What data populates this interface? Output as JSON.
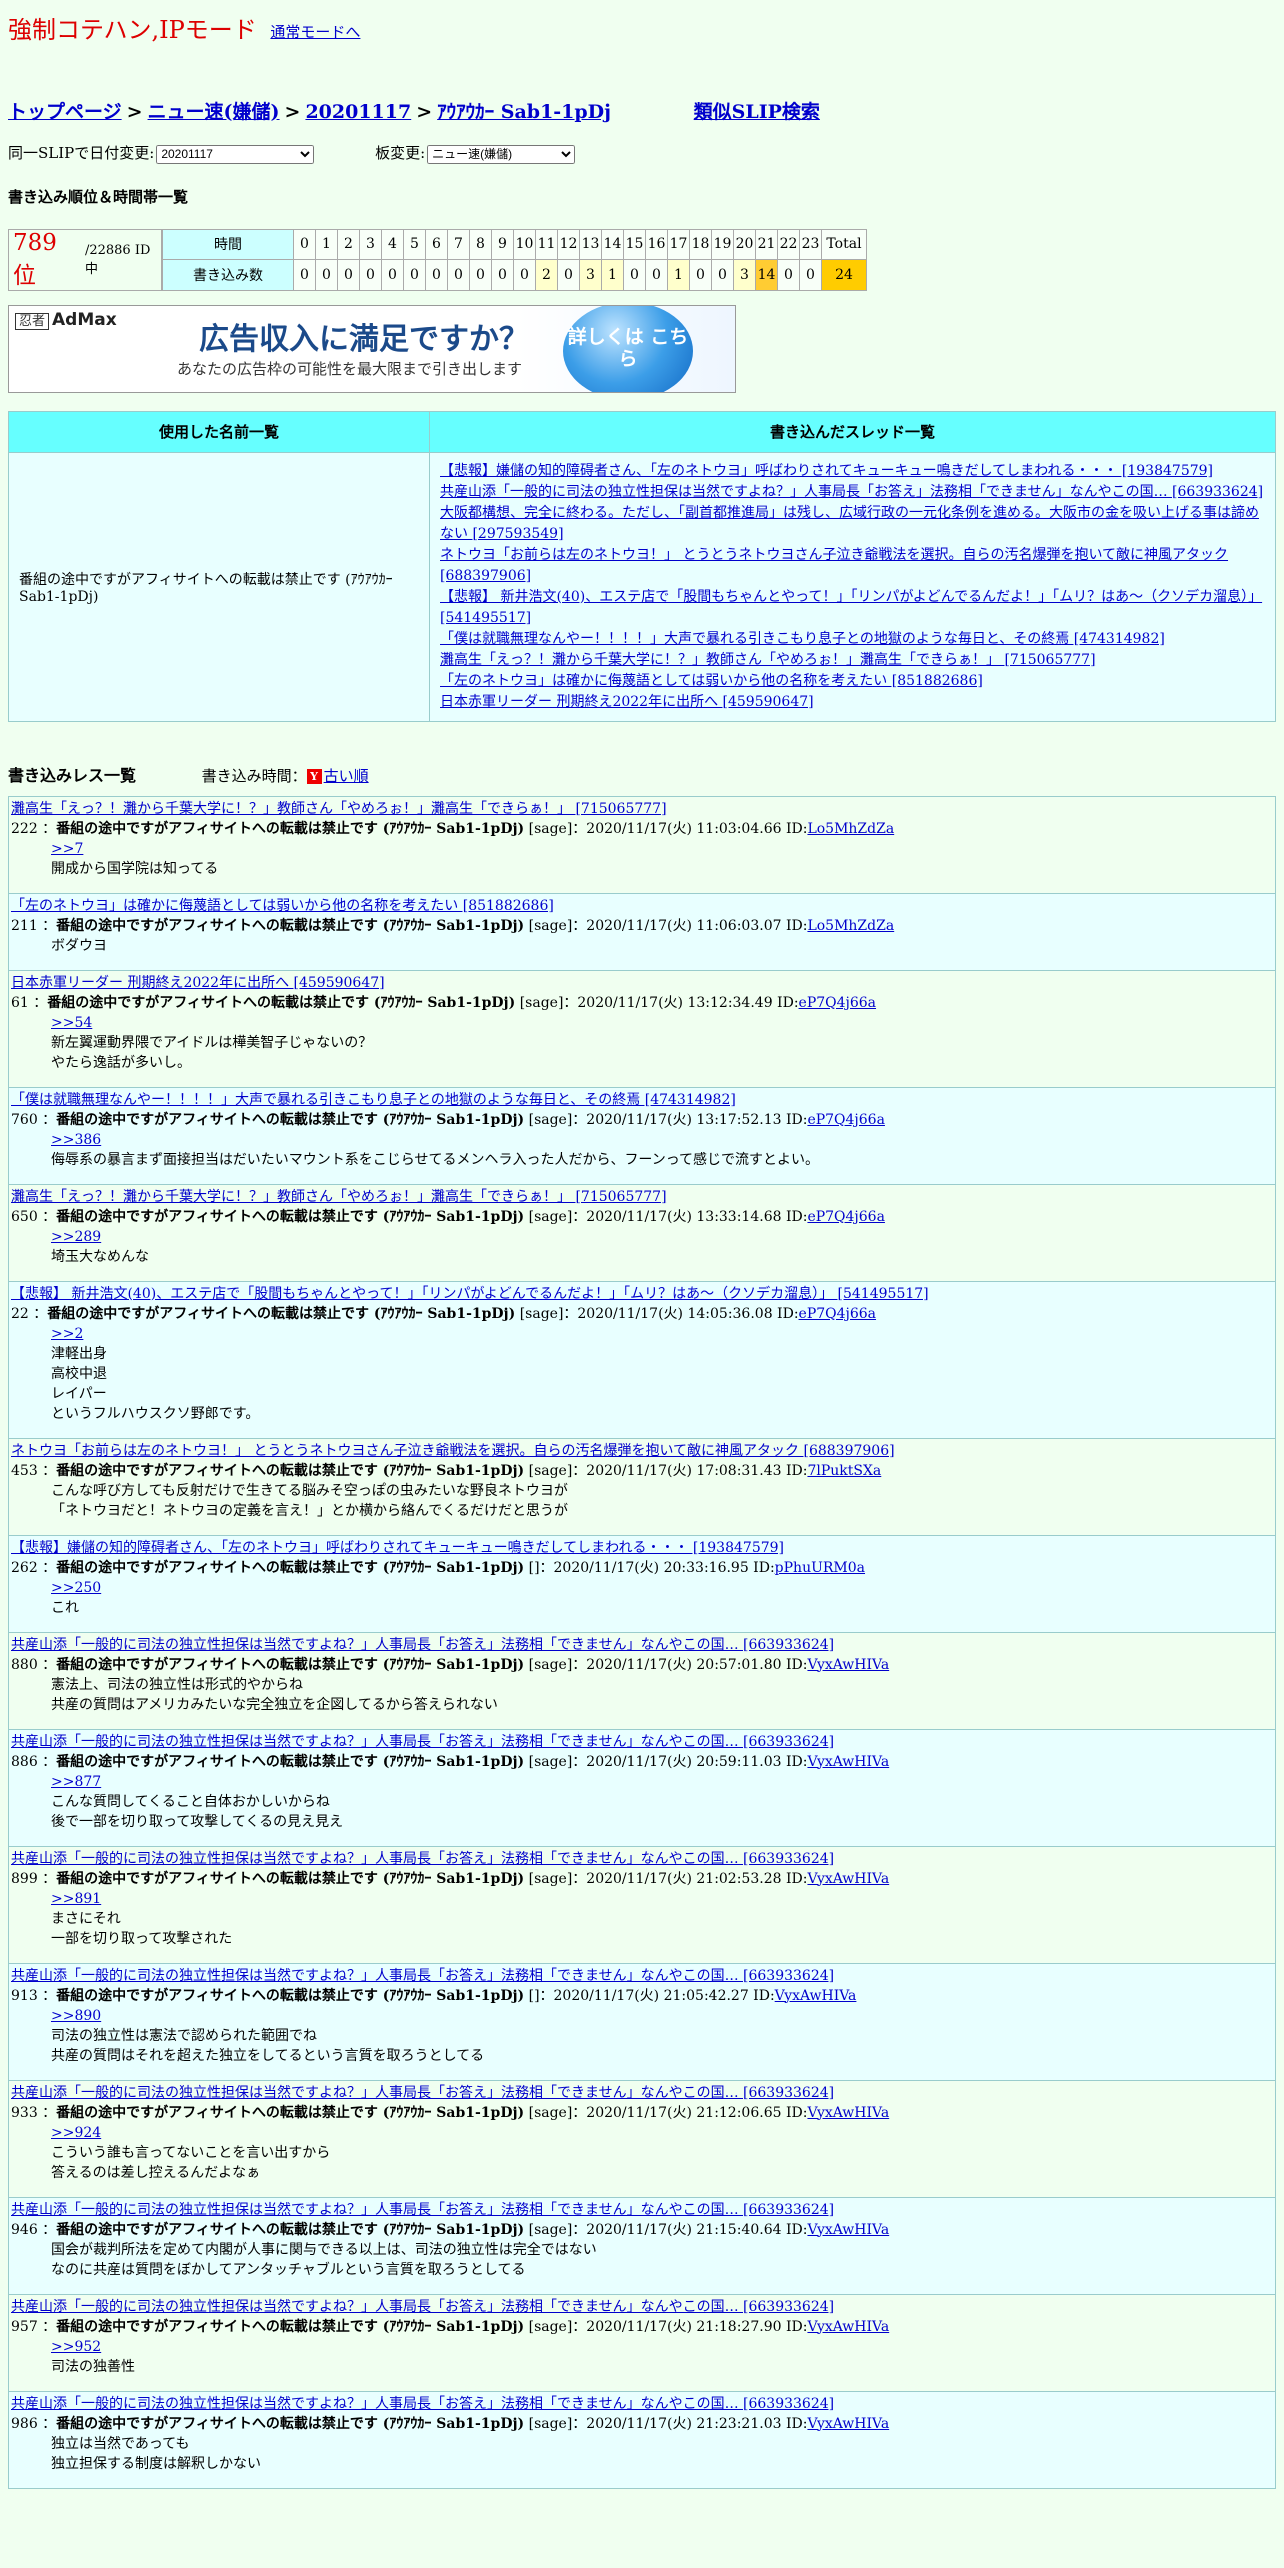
{
  "header": {
    "title": "強制コテハン,IPモード",
    "mode_link": "通常モードへ"
  },
  "breadcrumb": {
    "top": "トップページ",
    "board": "ニュー速(嫌儲)",
    "date": "20201117",
    "slip": "ｱｳｱｳｶｰ Sab1-1pDj",
    "similar": "類似SLIP検索",
    "sep": ">"
  },
  "selects": {
    "date_label": "同一SLIPで日付変更:",
    "date_value": "20201117",
    "board_label": "板変更:",
    "board_value": "ニュー速(嫌儲)"
  },
  "rank": {
    "heading": "書き込み順位＆時間帯一覧",
    "position": "789 位",
    "total": "/22886 ID中",
    "time_label": "時間",
    "count_label": "書き込み数",
    "hours": [
      "0",
      "1",
      "2",
      "3",
      "4",
      "5",
      "6",
      "7",
      "8",
      "9",
      "10",
      "11",
      "12",
      "13",
      "14",
      "15",
      "16",
      "17",
      "18",
      "19",
      "20",
      "21",
      "22",
      "23",
      "Total"
    ],
    "counts": [
      "0",
      "0",
      "0",
      "0",
      "0",
      "0",
      "0",
      "0",
      "0",
      "0",
      "0",
      "2",
      "0",
      "3",
      "1",
      "0",
      "0",
      "1",
      "0",
      "0",
      "3",
      "14",
      "0",
      "0",
      "24"
    ]
  },
  "ad": {
    "logo": "忍者",
    "logo2": "AdMax",
    "line1": "広告収入に満足ですか？",
    "line2": "あなたの広告枠の可能性を最大限まで引き出します",
    "badge": "詳しくは こちら"
  },
  "names_table": {
    "col1": "使用した名前一覧",
    "col2": "書き込んだスレッド一覧",
    "name": "番組の途中ですがアフィサイトへの転載は禁止です (ｱｳｱｳｶｰ Sab1-1pDj)",
    "threads": [
      "【悲報】嫌儲の知的障碍者さん、「左のネトウヨ」呼ばわりされてキューキュー鳴きだしてしまわれる・・・ [193847579]",
      "共産山添「一般的に司法の独立性担保は当然ですよね？」人事局長「お答え」法務相「できません」なんやこの国… [663933624]",
      "大阪都構想、完全に終わる。ただし、「副首都推進局」は残し、広域行政の一元化条例を進める。大阪市の金を吸い上げる事は諦めない [297593549]",
      "ネトウヨ「お前らは左のネトウヨ！」 とうとうネトウヨさん子泣き爺戦法を選択。自らの汚名爆弾を抱いて敵に神風アタック [688397906]",
      "【悲報】 新井浩文(40)、エステ店で「股間もちゃんとやって！」「リンパがよどんでるんだよ！」「ムリ？はあ～（クソデカ溜息）」 [541495517]",
      "「僕は就職無理なんやー！！！！」大声で暴れる引きこもり息子との地獄のような毎日と、その終焉 [474314982]",
      "灘高生「えっ？！灘から千葉大学に！？」教師さん「やめろぉ！」灘高生「できらぁ！」 [715065777]",
      "「左のネトウヨ」は確かに侮蔑語としては弱いから他の名称を考えたい [851882686]",
      "日本赤軍リーダー 刑期終え2022年に出所へ [459590647]"
    ]
  },
  "posts_section": {
    "heading": "書き込みレス一覧",
    "time_label": "書き込み時間：",
    "icon": "Y",
    "order_link": "古い順"
  },
  "posts": [
    {
      "thread": "灘高生「えっ？！灘から千葉大学に！？」教師さん「やめろぉ！」灘高生「できらぁ！」 [715065777]",
      "num": "222 ：",
      "name": "番組の途中ですがアフィサイトへの転載は禁止です (ｱｳｱｳｶｰ Sab1-1pDj)",
      "meta": " [sage]：2020/11/17(火) 11:03:04.66 ID:",
      "id": "Lo5MhZdZa",
      "anchor": ">>7",
      "lines": [
        "開成から国学院は知ってる"
      ]
    },
    {
      "thread": "「左のネトウヨ」は確かに侮蔑語としては弱いから他の名称を考えたい [851882686]",
      "num": "211 ：",
      "name": "番組の途中ですがアフィサイトへの転載は禁止です (ｱｳｱｳｶｰ Sab1-1pDj)",
      "meta": " [sage]：2020/11/17(火) 11:06:03.07 ID:",
      "id": "Lo5MhZdZa",
      "anchor": "",
      "lines": [
        "ボダウヨ"
      ]
    },
    {
      "thread": "日本赤軍リーダー 刑期終え2022年に出所へ [459590647]",
      "num": "61 ：",
      "name": "番組の途中ですがアフィサイトへの転載は禁止です (ｱｳｱｳｶｰ Sab1-1pDj)",
      "meta": " [sage]：2020/11/17(火) 13:12:34.49 ID:",
      "id": "eP7Q4j66a",
      "anchor": ">>54",
      "lines": [
        "新左翼運動界隈でアイドルは樺美智子じゃないの？",
        "やたら逸話が多いし。"
      ]
    },
    {
      "thread": "「僕は就職無理なんやー！！！！」大声で暴れる引きこもり息子との地獄のような毎日と、その終焉 [474314982]",
      "num": "760 ：",
      "name": "番組の途中ですがアフィサイトへの転載は禁止です (ｱｳｱｳｶｰ Sab1-1pDj)",
      "meta": " [sage]：2020/11/17(火) 13:17:52.13 ID:",
      "id": "eP7Q4j66a",
      "anchor": ">>386",
      "lines": [
        "侮辱系の暴言まず面接担当はだいたいマウント系をこじらせてるメンヘラ入った人だから、フーンって感じで流すとよい。"
      ]
    },
    {
      "thread": "灘高生「えっ？！灘から千葉大学に！？」教師さん「やめろぉ！」灘高生「できらぁ！」 [715065777]",
      "num": "650 ：",
      "name": "番組の途中ですがアフィサイトへの転載は禁止です (ｱｳｱｳｶｰ Sab1-1pDj)",
      "meta": " [sage]：2020/11/17(火) 13:33:14.68 ID:",
      "id": "eP7Q4j66a",
      "anchor": ">>289",
      "lines": [
        "埼玉大なめんな"
      ]
    },
    {
      "thread": "【悲報】 新井浩文(40)、エステ店で「股間もちゃんとやって！」「リンパがよどんでるんだよ！」「ムリ？はあ～（クソデカ溜息）」 [541495517]",
      "num": "22 ：",
      "name": "番組の途中ですがアフィサイトへの転載は禁止です (ｱｳｱｳｶｰ Sab1-1pDj)",
      "meta": " [sage]：2020/11/17(火) 14:05:36.08 ID:",
      "id": "eP7Q4j66a",
      "anchor": ">>2",
      "lines": [
        "津軽出身",
        "高校中退",
        "レイパー",
        "というフルハウスクソ野郎です。"
      ]
    },
    {
      "thread": "ネトウヨ「お前らは左のネトウヨ！」 とうとうネトウヨさん子泣き爺戦法を選択。自らの汚名爆弾を抱いて敵に神風アタック [688397906]",
      "num": "453 ：",
      "name": "番組の途中ですがアフィサイトへの転載は禁止です (ｱｳｱｳｶｰ Sab1-1pDj)",
      "meta": " [sage]：2020/11/17(火) 17:08:31.43 ID:",
      "id": "7lPuktSXa",
      "anchor": "",
      "lines": [
        "こんな呼び方しても反射だけで生きてる脳みそ空っぽの虫みたいな野良ネトウヨが",
        "「ネトウヨだと！ネトウヨの定義を言え！」とか横から絡んでくるだけだと思うが"
      ]
    },
    {
      "thread": "【悲報】嫌儲の知的障碍者さん、「左のネトウヨ」呼ばわりされてキューキュー鳴きだしてしまわれる・・・ [193847579]",
      "num": "262 ：",
      "name": "番組の途中ですがアフィサイトへの転載は禁止です (ｱｳｱｳｶｰ Sab1-1pDj)",
      "meta": " []：2020/11/17(火) 20:33:16.95 ID:",
      "id": "pPhuURM0a",
      "anchor": ">>250",
      "lines": [
        "これ"
      ]
    },
    {
      "thread": "共産山添「一般的に司法の独立性担保は当然ですよね？」人事局長「お答え」法務相「できません」なんやこの国… [663933624]",
      "num": "880 ：",
      "name": "番組の途中ですがアフィサイトへの転載は禁止です (ｱｳｱｳｶｰ Sab1-1pDj)",
      "meta": " [sage]：2020/11/17(火) 20:57:01.80 ID:",
      "id": "VyxAwHIVa",
      "anchor": "",
      "lines": [
        "憲法上、司法の独立性は形式的やからね",
        "共産の質問はアメリカみたいな完全独立を企図してるから答えられない"
      ]
    },
    {
      "thread": "共産山添「一般的に司法の独立性担保は当然ですよね？」人事局長「お答え」法務相「できません」なんやこの国… [663933624]",
      "num": "886 ：",
      "name": "番組の途中ですがアフィサイトへの転載は禁止です (ｱｳｱｳｶｰ Sab1-1pDj)",
      "meta": " [sage]：2020/11/17(火) 20:59:11.03 ID:",
      "id": "VyxAwHIVa",
      "anchor": ">>877",
      "lines": [
        "こんな質問してくること自体おかしいからね",
        "後で一部を切り取って攻撃してくるの見え見え"
      ]
    },
    {
      "thread": "共産山添「一般的に司法の独立性担保は当然ですよね？」人事局長「お答え」法務相「できません」なんやこの国… [663933624]",
      "num": "899 ：",
      "name": "番組の途中ですがアフィサイトへの転載は禁止です (ｱｳｱｳｶｰ Sab1-1pDj)",
      "meta": " [sage]：2020/11/17(火) 21:02:53.28 ID:",
      "id": "VyxAwHIVa",
      "anchor": ">>891",
      "lines": [
        "まさにそれ",
        "一部を切り取って攻撃された"
      ]
    },
    {
      "thread": "共産山添「一般的に司法の独立性担保は当然ですよね？」人事局長「お答え」法務相「できません」なんやこの国… [663933624]",
      "num": "913 ：",
      "name": "番組の途中ですがアフィサイトへの転載は禁止です (ｱｳｱｳｶｰ Sab1-1pDj)",
      "meta": " []：2020/11/17(火) 21:05:42.27 ID:",
      "id": "VyxAwHIVa",
      "anchor": ">>890",
      "lines": [
        "司法の独立性は憲法で認められた範囲でね",
        "共産の質問はそれを超えた独立をしてるという言質を取ろうとしてる"
      ]
    },
    {
      "thread": "共産山添「一般的に司法の独立性担保は当然ですよね？」人事局長「お答え」法務相「できません」なんやこの国… [663933624]",
      "num": "933 ：",
      "name": "番組の途中ですがアフィサイトへの転載は禁止です (ｱｳｱｳｶｰ Sab1-1pDj)",
      "meta": " [sage]：2020/11/17(火) 21:12:06.65 ID:",
      "id": "VyxAwHIVa",
      "anchor": ">>924",
      "lines": [
        "こういう誰も言ってないことを言い出すから",
        "答えるのは差し控えるんだよなぁ"
      ]
    },
    {
      "thread": "共産山添「一般的に司法の独立性担保は当然ですよね？」人事局長「お答え」法務相「できません」なんやこの国… [663933624]",
      "num": "946 ：",
      "name": "番組の途中ですがアフィサイトへの転載は禁止です (ｱｳｱｳｶｰ Sab1-1pDj)",
      "meta": " [sage]：2020/11/17(火) 21:15:40.64 ID:",
      "id": "VyxAwHIVa",
      "anchor": "",
      "lines": [
        "国会が裁判所法を定めて内閣が人事に関与できる以上は、司法の独立性は完全ではない",
        "なのに共産は質問をぼかしてアンタッチャブルという言質を取ろうとしてる"
      ]
    },
    {
      "thread": "共産山添「一般的に司法の独立性担保は当然ですよね？」人事局長「お答え」法務相「できません」なんやこの国… [663933624]",
      "num": "957 ：",
      "name": "番組の途中ですがアフィサイトへの転載は禁止です (ｱｳｱｳｶｰ Sab1-1pDj)",
      "meta": " [sage]：2020/11/17(火) 21:18:27.90 ID:",
      "id": "VyxAwHIVa",
      "anchor": ">>952",
      "lines": [
        "司法の独善性"
      ]
    },
    {
      "thread": "共産山添「一般的に司法の独立性担保は当然ですよね？」人事局長「お答え」法務相「できません」なんやこの国… [663933624]",
      "num": "986 ：",
      "name": "番組の途中ですがアフィサイトへの転載は禁止です (ｱｳｱｳｶｰ Sab1-1pDj)",
      "meta": " [sage]：2020/11/17(火) 21:23:21.03 ID:",
      "id": "VyxAwHIVa",
      "anchor": "",
      "lines": [
        "独立は当然であっても",
        "独立担保する制度は解釈しかない"
      ]
    }
  ]
}
